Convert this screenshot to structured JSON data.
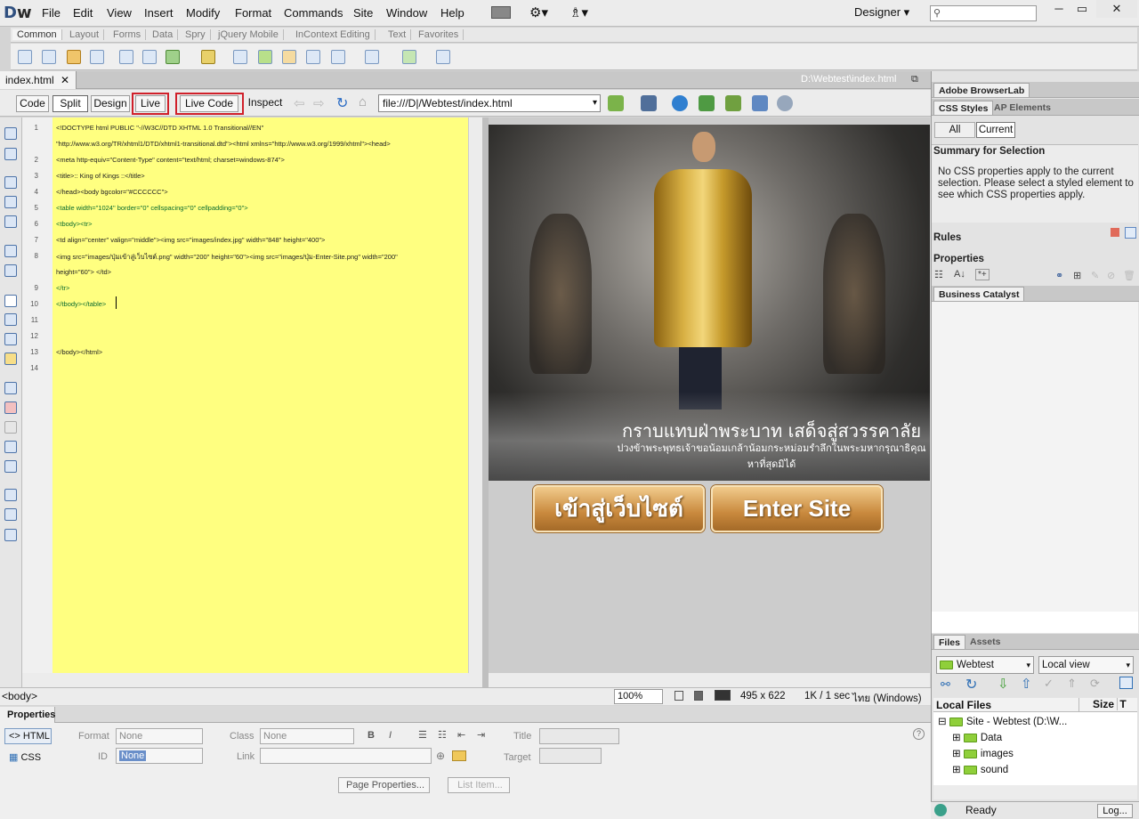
{
  "app": {
    "logo_d": "D",
    "logo_w": "w",
    "workspace": "Designer",
    "workspace_arrow": "▾",
    "window_buttons": {
      "min": "─",
      "max": "▭",
      "close": "✕"
    }
  },
  "menu": [
    "File",
    "Edit",
    "View",
    "Insert",
    "Modify",
    "Format",
    "Commands",
    "Site",
    "Window",
    "Help"
  ],
  "insert_tabs": [
    "Common",
    "Layout",
    "Forms",
    "Data",
    "Spry",
    "jQuery Mobile",
    "InContext Editing",
    "Text",
    "Favorites"
  ],
  "document": {
    "tab": "index.html",
    "close": "✕",
    "path": "D:\\Webtest\\index.html"
  },
  "view_buttons": {
    "code": "Code",
    "split": "Split",
    "design": "Design",
    "live": "Live",
    "live_code": "Live Code",
    "inspect": "Inspect"
  },
  "address": "file:///D|/Webtest/index.html",
  "line_numbers": [
    "1",
    "2",
    "3",
    "4",
    "5",
    "6",
    "7",
    "8",
    "9",
    "10",
    "11",
    "12",
    "13",
    "14"
  ],
  "code_lines": [
    {
      "n": "1",
      "text": "<!DOCTYPE html PUBLIC \"-//W3C//DTD XHTML 1.0 Transitional//EN\""
    },
    {
      "n": "",
      "text": "\"http://www.w3.org/TR/xhtml1/DTD/xhtml1-transitional.dtd\"><html xmlns=\"http://www.w3.org/1999/xhtml\"><head>"
    },
    {
      "n": "2",
      "text": "<meta http-equiv=\"Content-Type\" content=\"text/html; charset=windows-874\">"
    },
    {
      "n": "3",
      "text": "<title>:: King of Kings ::</title>"
    },
    {
      "n": "4",
      "text": "</head><body bgcolor=\"#CCCCCC\">"
    },
    {
      "n": "5",
      "text": "<table width=\"1024\" border=\"0\" cellspacing=\"0\" cellpadding=\"0\">"
    },
    {
      "n": "6",
      "text": "  <tbody><tr>"
    },
    {
      "n": "7",
      "text": "    <td align=\"center\" valign=\"middle\"><img src=\"images/index.jpg\" width=\"848\" height=\"400\">"
    },
    {
      "n": "8",
      "text": "      <img src=\"images/ปุ่มเข้าสู่เว็บไซต์.png\" width=\"200\" height=\"60\"><img src=\"images/ปุ่ม-Enter-Site.png\" width=\"200\""
    },
    {
      "n": "",
      "text": "height=\"60\">    </td>"
    },
    {
      "n": "9",
      "text": "  </tr>"
    },
    {
      "n": "10",
      "text": "</tbody></table>"
    },
    {
      "n": "11",
      "text": ""
    },
    {
      "n": "12",
      "text": ""
    },
    {
      "n": "13",
      "text": "</body></html>"
    },
    {
      "n": "14",
      "text": ""
    }
  ],
  "banner": {
    "line1": "กราบแทบฝ่าพระบาท เสด็จสู่สวรรคาลัย",
    "line2": "ปวงข้าพระพุทธเจ้าขอน้อมเกล้าน้อมกระหม่อมรำลึกในพระมหากรุณาธิคุณหาที่สุดมิได้"
  },
  "buttons": {
    "thai_enter": "เข้าสู่เว็บไซต์",
    "enter": "Enter Site"
  },
  "status": {
    "tag": "<body>",
    "zoom": "100%",
    "dims": "495 x 622",
    "size": "1K / 1 sec",
    "encoding": "ไทย (Windows)"
  },
  "properties": {
    "title": "Properties",
    "html": "HTML",
    "css": "CSS",
    "format_label": "Format",
    "format_value": "None",
    "class_label": "Class",
    "class_value": "None",
    "id_label": "ID",
    "id_value": "None",
    "link_label": "Link",
    "title_label": "Title",
    "target_label": "Target",
    "page_props": "Page Properties...",
    "list_item": "List Item..."
  },
  "panels": {
    "browserlab": "Adobe BrowserLab",
    "css_styles": "CSS Styles",
    "ap_elements": "AP Elements",
    "all": "All",
    "current": "Current",
    "summary_title": "Summary for Selection",
    "summary_text": "No CSS properties apply to the current selection.  Please select a styled element to see which CSS properties apply.",
    "rules": "Rules",
    "properties": "Properties",
    "business_catalyst": "Business Catalyst",
    "files": "Files",
    "assets": "Assets",
    "site": "Webtest",
    "view": "Local view",
    "local_files": "Local Files",
    "size": "Size",
    "size_t": "T",
    "tree": [
      "Site - Webtest (D:\\W...",
      "Data",
      "images",
      "sound"
    ],
    "ready": "Ready",
    "log": "Log..."
  }
}
